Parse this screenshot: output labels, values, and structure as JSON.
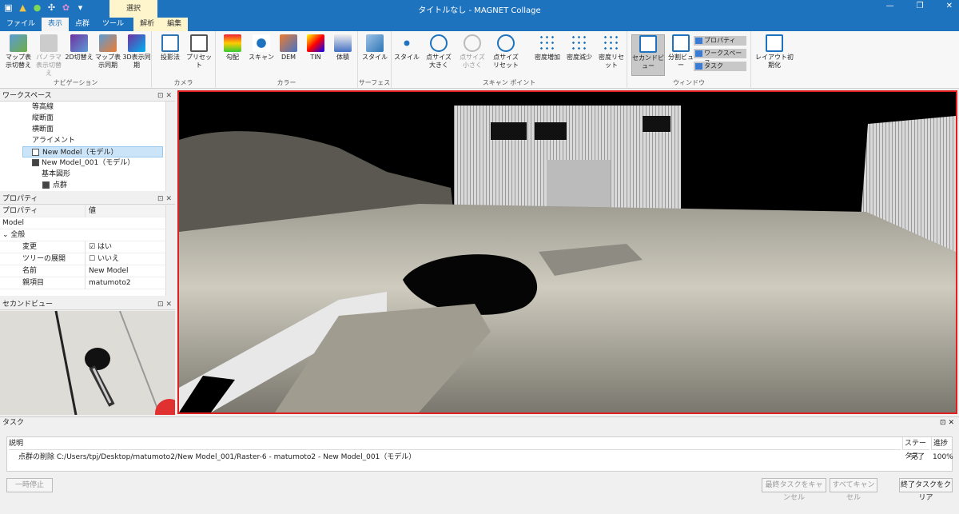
{
  "window": {
    "title": "タイトルなし - MAGNET Collage",
    "context_tab": "選択"
  },
  "menu": {
    "tabs": [
      "ファイル",
      "表示",
      "点群",
      "ツール",
      "解析",
      "編集"
    ]
  },
  "ribbon": {
    "navigation": {
      "label": "ナビゲーション",
      "buttons": [
        "マップ表示切替え",
        "パノラマ表示切替え",
        "2D切替え",
        "マップ表示同期",
        "3D表示同期"
      ]
    },
    "camera": {
      "label": "カメラ",
      "buttons": [
        "投影法",
        "プリセット"
      ]
    },
    "color": {
      "label": "カラー",
      "buttons": [
        "勾配",
        "スキャン",
        "DEM",
        "TIN",
        "体積"
      ]
    },
    "surface": {
      "label": "サーフェス",
      "buttons": [
        "スタイル"
      ]
    },
    "scan_point": {
      "label": "スキャン ポイント",
      "buttons": [
        "スタイル",
        "点サイズ大きく",
        "点サイズ小さく",
        "点サイズリセット",
        "密度増加",
        "密度減少",
        "密度リセット"
      ]
    },
    "window": {
      "label": "ウィンドウ",
      "buttons": [
        "セカンドビュー",
        "分割ビュー"
      ],
      "checks": [
        "プロパティ",
        "ワークスペース",
        "タスク"
      ],
      "reset": "レイアウト初期化"
    }
  },
  "workspace": {
    "title": "ワークスペース",
    "items": [
      "等高線",
      "縦断面",
      "横断面",
      "アライメント",
      "New Model（モデル）",
      "New Model_001（モデル）",
      "基本図形",
      "点群"
    ]
  },
  "properties": {
    "title": "プロパティ",
    "header_key": "プロパティ",
    "header_value": "値",
    "object": "Model",
    "section": "全般",
    "rows": [
      {
        "key": "変更",
        "value": "はい"
      },
      {
        "key": "ツリーの展開",
        "value": "いいえ"
      },
      {
        "key": "名前",
        "value": "New Model"
      },
      {
        "key": "親項目",
        "value": "matumoto2"
      }
    ]
  },
  "second_view": {
    "title": "セカンドビュー"
  },
  "tasks": {
    "title": "タスク",
    "columns": {
      "description": "説明",
      "status": "ステータス",
      "progress": "進捗"
    },
    "rows": [
      {
        "description": "点群の削除 C:/Users/tpj/Desktop/matumoto2/New Model_001/Raster-6 - matumoto2 - New Model_001（モデル）",
        "status": "完了",
        "progress": "100%"
      }
    ],
    "buttons": {
      "pause": "一時停止",
      "cancel_last": "最終タスクをキャンセル",
      "cancel_all": "すべてキャンセル",
      "clear_done": "終了タスクをクリア"
    }
  }
}
